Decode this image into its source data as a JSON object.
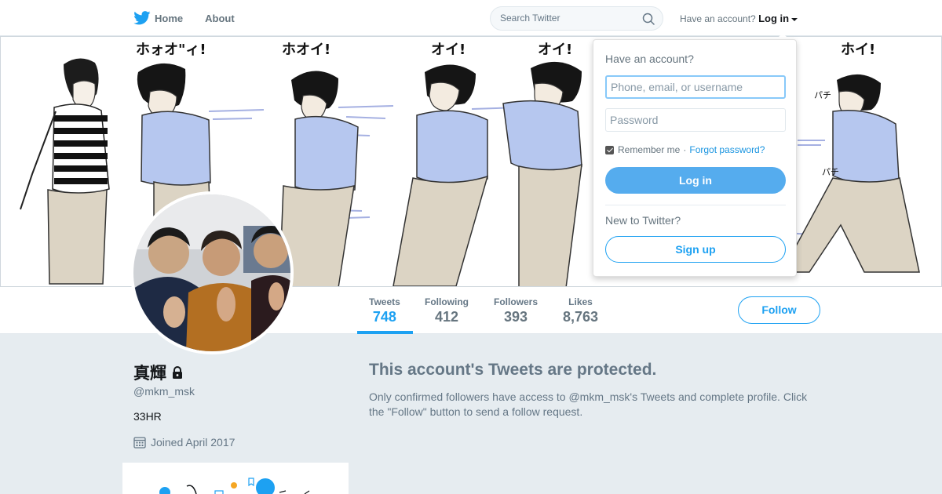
{
  "nav": {
    "home_label": "Home",
    "about_label": "About",
    "search_placeholder": "Search Twitter",
    "have_account": "Have an account?",
    "login_label": "Log in"
  },
  "banner": {
    "caption_1": "ホォオ\"ィ!",
    "caption_2": "ホオイ!",
    "caption_3": "オイ!",
    "caption_4": "オイ!",
    "caption_5": "ホイ!",
    "caption_6": "パチ",
    "caption_7": "パチ"
  },
  "stats": [
    {
      "label": "Tweets",
      "value": "748"
    },
    {
      "label": "Following",
      "value": "412"
    },
    {
      "label": "Followers",
      "value": "393"
    },
    {
      "label": "Likes",
      "value": "8,763"
    }
  ],
  "follow_label": "Follow",
  "profile": {
    "name": "真輝",
    "handle": "@mkm_msk",
    "bio": "33HR",
    "joined": "Joined April 2017"
  },
  "protected": {
    "title": "This account's Tweets are protected.",
    "text": "Only confirmed followers have access to @mkm_msk's Tweets and complete profile. Click the \"Follow\" button to send a follow request."
  },
  "login_dropdown": {
    "heading": "Have an account?",
    "username_placeholder": "Phone, email, or username",
    "password_placeholder": "Password",
    "remember_label": "Remember me",
    "separator": "·",
    "forgot_label": "Forgot password?",
    "login_button": "Log in",
    "new_heading": "New to Twitter?",
    "signup_button": "Sign up"
  },
  "colors": {
    "accent": "#1da1f2",
    "login_button": "#55acee",
    "page_bg": "#e6ecf0"
  }
}
